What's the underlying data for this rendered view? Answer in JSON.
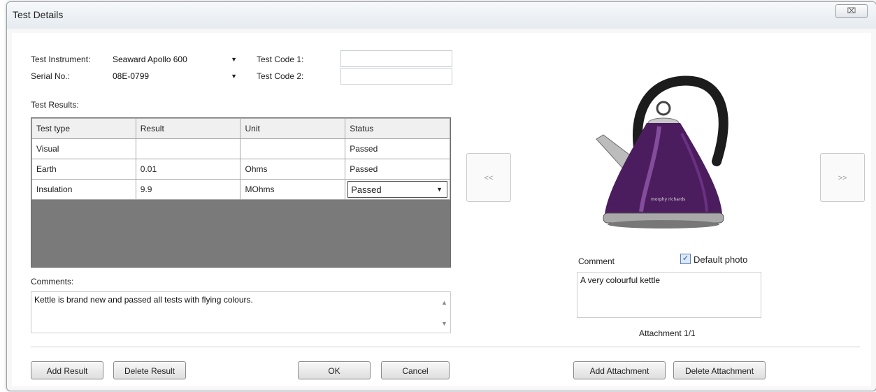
{
  "window": {
    "title": "Test Details",
    "close_glyph": "⌧"
  },
  "form": {
    "instrument_label": "Test Instrument:",
    "instrument_value": "Seaward Apollo 600",
    "serial_label": "Serial No.:",
    "serial_value": "08E-0799",
    "code1_label": "Test Code 1:",
    "code1_value": "",
    "code2_label": "Test Code 2:",
    "code2_value": "",
    "results_label": "Test Results:",
    "comments_label": "Comments:",
    "comments_value": "Kettle is brand new and passed all tests with flying colours."
  },
  "results_table": {
    "headers": [
      "Test type",
      "Result",
      "Unit",
      "Status"
    ],
    "rows": [
      [
        "Visual",
        "",
        "",
        "Passed"
      ],
      [
        "Earth",
        "0.01",
        "Ohms",
        "Passed"
      ],
      [
        "Insulation",
        "9.9",
        "MOhms",
        "Passed"
      ]
    ]
  },
  "attachment": {
    "prev_label": "<<",
    "next_label": ">>",
    "comment_label": "Comment",
    "default_photo_label": "Default photo",
    "default_photo_checked": true,
    "comment_value": "A very colourful kettle",
    "counter": "Attachment 1/1",
    "brand_text": "morphy richards"
  },
  "buttons": {
    "add_result": "Add Result",
    "delete_result": "Delete Result",
    "ok": "OK",
    "cancel": "Cancel",
    "add_attachment": "Add Attachment",
    "delete_attachment": "Delete Attachment"
  },
  "icons": {
    "dropdown": "chevron-down-icon",
    "scroll_up": "scroll-up-icon",
    "scroll_down": "scroll-down-icon",
    "check": "check-icon"
  },
  "colors": {
    "grid_empty_area": "#7a7a7a",
    "kettle_body": "#4b1d5e"
  }
}
